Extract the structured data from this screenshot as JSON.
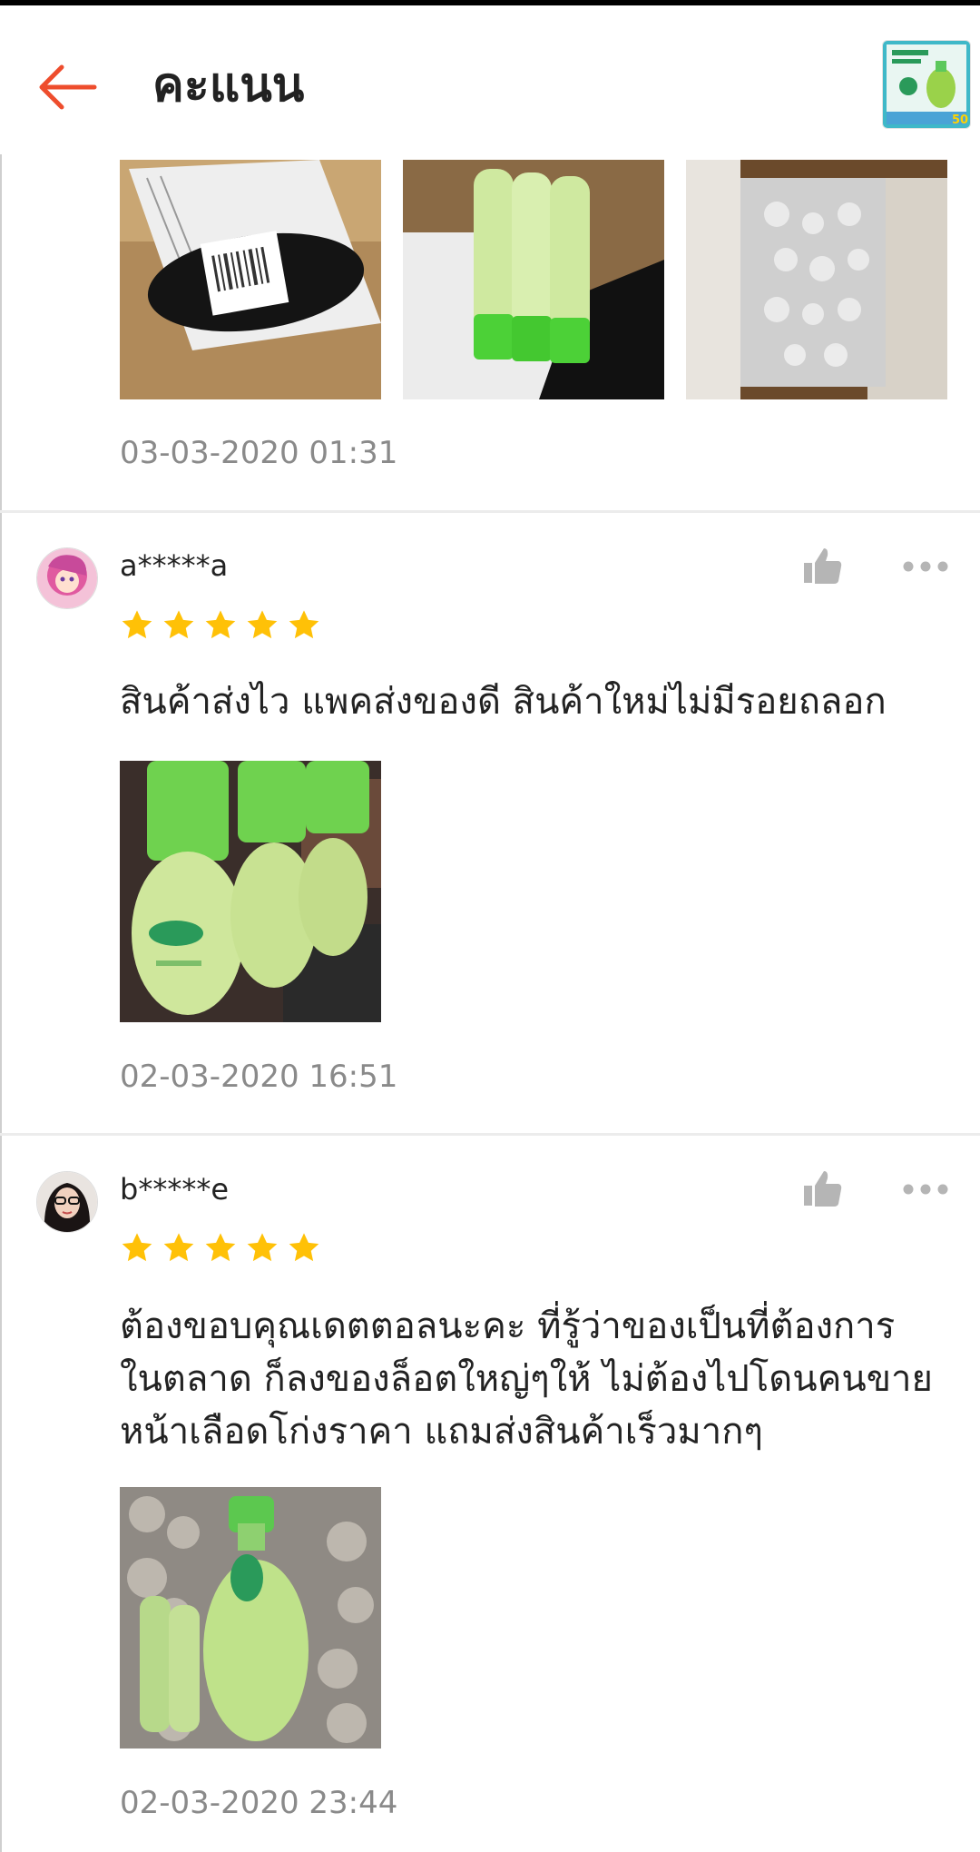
{
  "header": {
    "title": "คะแนน",
    "back_icon": "arrow-left-icon",
    "accent_color": "#ee4d2d",
    "product_thumb_badge": "50"
  },
  "reviews": [
    {
      "date": "03-03-2020 01:31",
      "photos": [
        "package-photo",
        "bottles-photo",
        "bubble-wrap-box-photo"
      ]
    },
    {
      "username": "a*****a",
      "rating": 5,
      "text": "สินค้าส่งไว แพคส่งของดี สินค้าใหม่ไม่มีรอยถลอก",
      "photos": [
        "dettol-bottles-photo"
      ],
      "date": "02-03-2020 16:51"
    },
    {
      "username": "b*****e",
      "rating": 5,
      "text_lines": [
        "ต้องขอบคุณเดตตอลนะคะ ที่รู้ว่าของเป็นที่ต้องการ",
        "ในตลาด ก็ลงของล็อตใหญ่ๆให้ ไม่ต้องไปโดนคนขาย",
        "หน้าเลือดโก่งราคา แถมส่งสินค้าเร็วมากๆ"
      ],
      "photos": [
        "dettol-pump-bottle-photo"
      ],
      "date": "02-03-2020 23:44"
    }
  ],
  "colors": {
    "star": "#ffc107",
    "date_text": "#8a8a8a",
    "icon_gray": "#b5b5b5"
  }
}
